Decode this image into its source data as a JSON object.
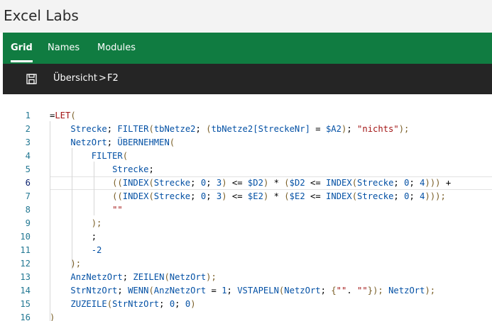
{
  "app": {
    "title": "Excel Labs"
  },
  "tabs": [
    {
      "label": "Grid",
      "active": true
    },
    {
      "label": "Names",
      "active": false
    },
    {
      "label": "Modules",
      "active": false
    }
  ],
  "toolbar": {
    "save_icon": "save-icon",
    "breadcrumb": {
      "sheet": "Übersicht",
      "separator": ">",
      "cell": "F2"
    }
  },
  "colors": {
    "tab_bar": "#107c41",
    "toolbar": "#252525",
    "function": "#795e26",
    "reference": "#0451a5",
    "operator": "#000000",
    "string": "#a31515",
    "punctuation": "#000000",
    "line_number": "#237893"
  },
  "editor": {
    "current_line": 6,
    "lines": [
      {
        "n": "1",
        "tokens": [
          {
            "t": "=",
            "c": "operator"
          },
          {
            "t": "LET",
            "c": "string"
          },
          {
            "t": "(",
            "c": "function"
          }
        ]
      },
      {
        "n": "2",
        "tokens": [
          {
            "t": "    ",
            "c": "operator"
          },
          {
            "t": "Strecke",
            "c": "reference"
          },
          {
            "t": "; ",
            "c": "operator"
          },
          {
            "t": "FILTER",
            "c": "reference"
          },
          {
            "t": "(",
            "c": "function"
          },
          {
            "t": "tbNetze2",
            "c": "reference"
          },
          {
            "t": "; ",
            "c": "operator"
          },
          {
            "t": "(",
            "c": "function"
          },
          {
            "t": "tbNetze2[StreckeNr]",
            "c": "reference"
          },
          {
            "t": " = ",
            "c": "operator"
          },
          {
            "t": "$A2",
            "c": "reference"
          },
          {
            "t": ")",
            "c": "function"
          },
          {
            "t": "; ",
            "c": "operator"
          },
          {
            "t": "\"nichts\"",
            "c": "string"
          },
          {
            "t": ");",
            "c": "function"
          }
        ]
      },
      {
        "n": "3",
        "tokens": [
          {
            "t": "    ",
            "c": "operator"
          },
          {
            "t": "NetzOrt",
            "c": "reference"
          },
          {
            "t": "; ",
            "c": "operator"
          },
          {
            "t": "ÜBERNEHMEN",
            "c": "reference"
          },
          {
            "t": "(",
            "c": "function"
          }
        ]
      },
      {
        "n": "4",
        "tokens": [
          {
            "t": "        ",
            "c": "operator"
          },
          {
            "t": "FILTER",
            "c": "reference"
          },
          {
            "t": "(",
            "c": "function"
          }
        ]
      },
      {
        "n": "5",
        "tokens": [
          {
            "t": "            ",
            "c": "operator"
          },
          {
            "t": "Strecke",
            "c": "reference"
          },
          {
            "t": ";",
            "c": "operator"
          }
        ]
      },
      {
        "n": "6",
        "tokens": [
          {
            "t": "            ",
            "c": "operator"
          },
          {
            "t": "((",
            "c": "function"
          },
          {
            "t": "INDEX",
            "c": "reference"
          },
          {
            "t": "(",
            "c": "function"
          },
          {
            "t": "Strecke",
            "c": "reference"
          },
          {
            "t": "; ",
            "c": "operator"
          },
          {
            "t": "0",
            "c": "reference"
          },
          {
            "t": "; ",
            "c": "operator"
          },
          {
            "t": "3",
            "c": "reference"
          },
          {
            "t": ")",
            "c": "function"
          },
          {
            "t": " <= ",
            "c": "operator"
          },
          {
            "t": "$D2",
            "c": "reference"
          },
          {
            "t": ")",
            "c": "function"
          },
          {
            "t": " * ",
            "c": "operator"
          },
          {
            "t": "(",
            "c": "function"
          },
          {
            "t": "$D2",
            "c": "reference"
          },
          {
            "t": " <= ",
            "c": "operator"
          },
          {
            "t": "INDEX",
            "c": "reference"
          },
          {
            "t": "(",
            "c": "function"
          },
          {
            "t": "Strecke",
            "c": "reference"
          },
          {
            "t": "; ",
            "c": "operator"
          },
          {
            "t": "0",
            "c": "reference"
          },
          {
            "t": "; ",
            "c": "operator"
          },
          {
            "t": "4",
            "c": "reference"
          },
          {
            "t": ")))",
            "c": "function"
          },
          {
            "t": " +",
            "c": "operator"
          }
        ]
      },
      {
        "n": "7",
        "tokens": [
          {
            "t": "            ",
            "c": "operator"
          },
          {
            "t": "((",
            "c": "function"
          },
          {
            "t": "INDEX",
            "c": "reference"
          },
          {
            "t": "(",
            "c": "function"
          },
          {
            "t": "Strecke",
            "c": "reference"
          },
          {
            "t": "; ",
            "c": "operator"
          },
          {
            "t": "0",
            "c": "reference"
          },
          {
            "t": "; ",
            "c": "operator"
          },
          {
            "t": "3",
            "c": "reference"
          },
          {
            "t": ")",
            "c": "function"
          },
          {
            "t": " <= ",
            "c": "operator"
          },
          {
            "t": "$E2",
            "c": "reference"
          },
          {
            "t": ")",
            "c": "function"
          },
          {
            "t": " * ",
            "c": "operator"
          },
          {
            "t": "(",
            "c": "function"
          },
          {
            "t": "$E2",
            "c": "reference"
          },
          {
            "t": " <= ",
            "c": "operator"
          },
          {
            "t": "INDEX",
            "c": "reference"
          },
          {
            "t": "(",
            "c": "function"
          },
          {
            "t": "Strecke",
            "c": "reference"
          },
          {
            "t": "; ",
            "c": "operator"
          },
          {
            "t": "0",
            "c": "reference"
          },
          {
            "t": "; ",
            "c": "operator"
          },
          {
            "t": "4",
            "c": "reference"
          },
          {
            "t": ")));",
            "c": "function"
          }
        ]
      },
      {
        "n": "8",
        "tokens": [
          {
            "t": "            ",
            "c": "operator"
          },
          {
            "t": "\"\"",
            "c": "string"
          }
        ]
      },
      {
        "n": "9",
        "tokens": [
          {
            "t": "        ",
            "c": "operator"
          },
          {
            "t": ");",
            "c": "function"
          }
        ]
      },
      {
        "n": "10",
        "tokens": [
          {
            "t": "        ",
            "c": "operator"
          },
          {
            "t": ";",
            "c": "operator"
          }
        ]
      },
      {
        "n": "11",
        "tokens": [
          {
            "t": "        ",
            "c": "operator"
          },
          {
            "t": "-2",
            "c": "reference"
          }
        ]
      },
      {
        "n": "12",
        "tokens": [
          {
            "t": "    ",
            "c": "operator"
          },
          {
            "t": ");",
            "c": "function"
          }
        ]
      },
      {
        "n": "13",
        "tokens": [
          {
            "t": "    ",
            "c": "operator"
          },
          {
            "t": "AnzNetzOrt",
            "c": "reference"
          },
          {
            "t": "; ",
            "c": "operator"
          },
          {
            "t": "ZEILEN",
            "c": "reference"
          },
          {
            "t": "(",
            "c": "function"
          },
          {
            "t": "NetzOrt",
            "c": "reference"
          },
          {
            "t": ");",
            "c": "function"
          }
        ]
      },
      {
        "n": "14",
        "tokens": [
          {
            "t": "    ",
            "c": "operator"
          },
          {
            "t": "StrNtzOrt",
            "c": "reference"
          },
          {
            "t": "; ",
            "c": "operator"
          },
          {
            "t": "WENN",
            "c": "reference"
          },
          {
            "t": "(",
            "c": "function"
          },
          {
            "t": "AnzNetzOrt",
            "c": "reference"
          },
          {
            "t": " = ",
            "c": "operator"
          },
          {
            "t": "1",
            "c": "reference"
          },
          {
            "t": "; ",
            "c": "operator"
          },
          {
            "t": "VSTAPELN",
            "c": "reference"
          },
          {
            "t": "(",
            "c": "function"
          },
          {
            "t": "NetzOrt",
            "c": "reference"
          },
          {
            "t": "; ",
            "c": "operator"
          },
          {
            "t": "{",
            "c": "function"
          },
          {
            "t": "\"\"",
            "c": "string"
          },
          {
            "t": ". ",
            "c": "operator"
          },
          {
            "t": "\"\"",
            "c": "string"
          },
          {
            "t": "});",
            "c": "function"
          },
          {
            "t": " ",
            "c": "operator"
          },
          {
            "t": "NetzOrt",
            "c": "reference"
          },
          {
            "t": ");",
            "c": "function"
          }
        ]
      },
      {
        "n": "15",
        "tokens": [
          {
            "t": "    ",
            "c": "operator"
          },
          {
            "t": "ZUZEILE",
            "c": "reference"
          },
          {
            "t": "(",
            "c": "function"
          },
          {
            "t": "StrNtzOrt",
            "c": "reference"
          },
          {
            "t": "; ",
            "c": "operator"
          },
          {
            "t": "0",
            "c": "reference"
          },
          {
            "t": "; ",
            "c": "operator"
          },
          {
            "t": "0",
            "c": "reference"
          },
          {
            "t": ")",
            "c": "function"
          }
        ]
      },
      {
        "n": "16",
        "tokens": [
          {
            "t": ")",
            "c": "function"
          }
        ]
      }
    ]
  }
}
